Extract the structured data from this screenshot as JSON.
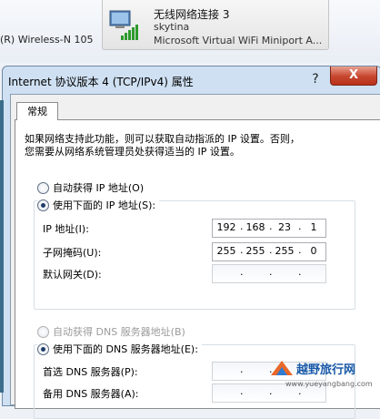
{
  "background": {
    "adapter_left": "(R) Wireless-N 105"
  },
  "network_tile": {
    "name": "无线网络连接 3",
    "ssid": "skytina",
    "adapter": "Microsoft Virtual WiFi Miniport A..."
  },
  "dialog": {
    "title": "Internet 协议版本 4 (TCP/IPv4) 属性",
    "help_label": "?",
    "close_label": "X",
    "tab_label": "常规",
    "description_line1": "如果网络支持此功能，则可以获取自动指派的 IP 设置。否则，",
    "description_line2": "您需要从网络系统管理员处获得适当的 IP 设置。",
    "ip_auto_label": "自动获得 IP 地址(O)",
    "ip_manual_label": "使用下面的 IP 地址(S):",
    "ip_address_label": "IP 地址(I):",
    "subnet_mask_label": "子网掩码(U):",
    "gateway_label": "默认网关(D):",
    "ip_address": [
      "192",
      "168",
      "23",
      "1"
    ],
    "subnet_mask": [
      "255",
      "255",
      "255",
      "0"
    ],
    "gateway": [
      "",
      "",
      "",
      ""
    ],
    "dns_auto_label": "自动获得 DNS 服务器地址(B)",
    "dns_manual_label": "使用下面的 DNS 服务器地址(E):",
    "preferred_dns_label": "首选 DNS 服务器(P):",
    "alternate_dns_label": "备用 DNS 服务器(A):",
    "ip_mode": "manual",
    "dns_mode": "manual"
  },
  "watermark": {
    "brand": "越野旅行网",
    "url": "www.yueyangbang.com"
  },
  "colors": {
    "dialog_frame": "#cfe0f2",
    "close_button": "#c7452e",
    "radio_dot": "#1f3d6a"
  }
}
